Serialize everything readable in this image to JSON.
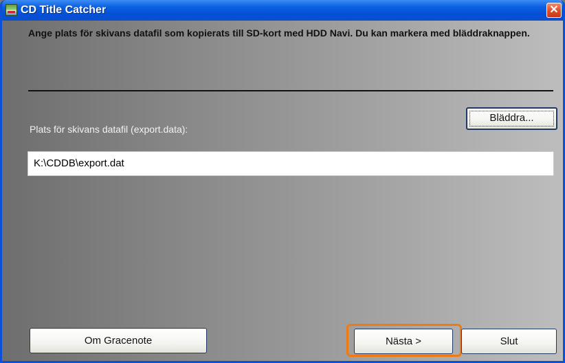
{
  "window": {
    "title": "CD Title Catcher",
    "close_symbol": "✕",
    "icon": "app-icon",
    "title_bar_color": "#0a5fe0",
    "highlight_color": "#f07a12"
  },
  "instruction": "Ange plats för skivans datafil som kopierats till SD-kort med HDD Navi. Du kan markera med bläddraknappen.",
  "browse_button": "Bläddra...",
  "field": {
    "label": "Plats för skivans datafil (export.data):",
    "value": "K:\\CDDB\\export.dat"
  },
  "buttons": {
    "about": "Om Gracenote",
    "next": "Nästa >",
    "quit": "Slut"
  }
}
